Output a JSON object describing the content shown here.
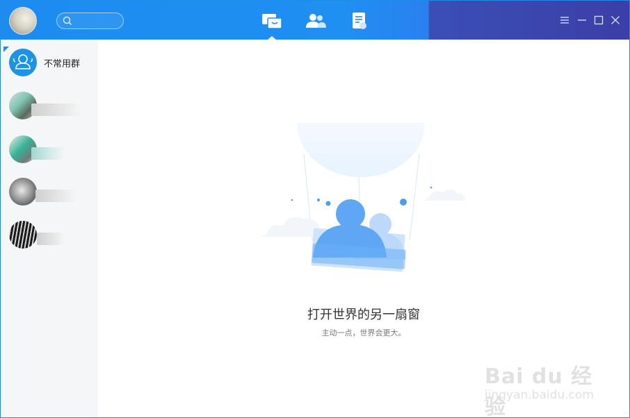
{
  "header": {
    "nav": [
      {
        "name": "messages",
        "active": true
      },
      {
        "name": "contacts",
        "active": false
      },
      {
        "name": "documents",
        "active": false
      }
    ],
    "window_controls": [
      "menu",
      "minimize",
      "maximize",
      "close"
    ]
  },
  "sidebar": {
    "items": [
      {
        "label": "不常用群",
        "type": "group"
      },
      {
        "label": "",
        "type": "contact"
      },
      {
        "label": "",
        "type": "contact"
      },
      {
        "label": "",
        "type": "contact"
      },
      {
        "label": "",
        "type": "contact"
      }
    ]
  },
  "main": {
    "title": "打开世界的另一扇窗",
    "subtitle": "主动一点，世界会更大。"
  },
  "colors": {
    "titlebar": "#1d8cf0",
    "titlebar_right": "#3b3fa7",
    "sidebar_bg": "#f5f6f7",
    "accent": "#1d8cf0"
  },
  "watermark": {
    "brand": "Bai du 经验",
    "url": "jingyan.baidu.com"
  }
}
